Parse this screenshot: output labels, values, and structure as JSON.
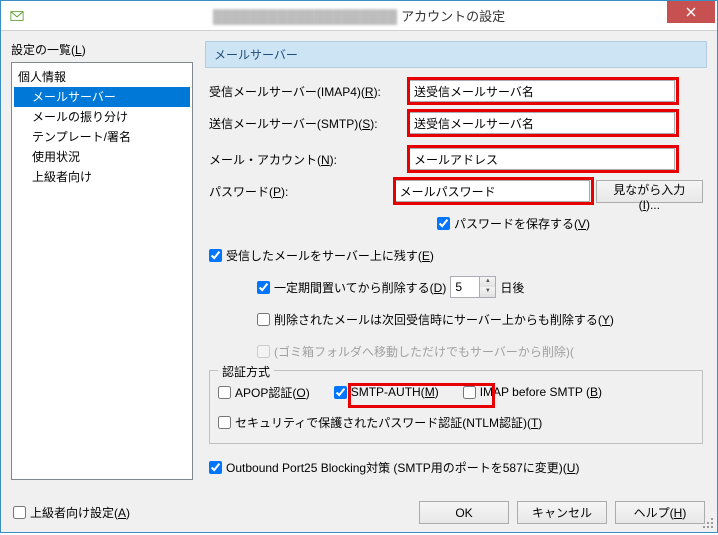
{
  "title": {
    "obscured": "████████████████████",
    "text": "アカウントの設定"
  },
  "left": {
    "header": "設定の一覧(L)",
    "items": [
      "個人情報",
      "メールサーバー",
      "メールの振り分け",
      "テンプレート/署名",
      "使用状況",
      "上級者向け"
    ],
    "selected_index": 1
  },
  "section": "メールサーバー",
  "fields": {
    "imap_label_pre": "受信メールサーバー(IMAP4)(",
    "imap_label_key": "R",
    "smtp_label_pre": "送信メールサーバー(SMTP)(",
    "smtp_label_key": "S",
    "account_label_pre": "メール・アカウント(",
    "account_label_key": "N",
    "password_label_pre": "パスワード(",
    "password_label_key": "P",
    "label_close": "):",
    "imap_value": "送受信メールサーバ名",
    "smtp_value": "送受信メールサーバ名",
    "account_value": "メールアドレス",
    "password_value": "メールパスワード",
    "watch_input_btn": "見ながら入力(I)...",
    "save_password": "パスワードを保存する(V)"
  },
  "server_opts": {
    "leave_on_server": "受信したメールをサーバー上に残す(E)",
    "delete_after_pre": "一定期間置いてから削除する(",
    "delete_after_key": "D",
    "delete_after_close": ")",
    "days_value": "5",
    "days_suffix": "日後",
    "delete_removed": "削除されたメールは次回受信時にサーバー上からも削除する(Y)",
    "trash_note": "(ゴミ箱フォルダへ移動しただけでもサーバーから削除)("
  },
  "auth": {
    "group_title": "認証方式",
    "apop": "APOP認証(O)",
    "smtp_auth": "SMTP-AUTH(M)",
    "imap_before": "IMAP before SMTP (B)",
    "ntlm": "セキュリティで保護されたパスワード認証(NTLM認証)(T)"
  },
  "outbound": "Outbound Port25 Blocking対策 (SMTP用のポートを587に変更)(U)",
  "advanced_settings": "上級者向け設定(A)",
  "buttons": {
    "ok": "OK",
    "cancel": "キャンセル",
    "help": "ヘルプ(H)"
  }
}
